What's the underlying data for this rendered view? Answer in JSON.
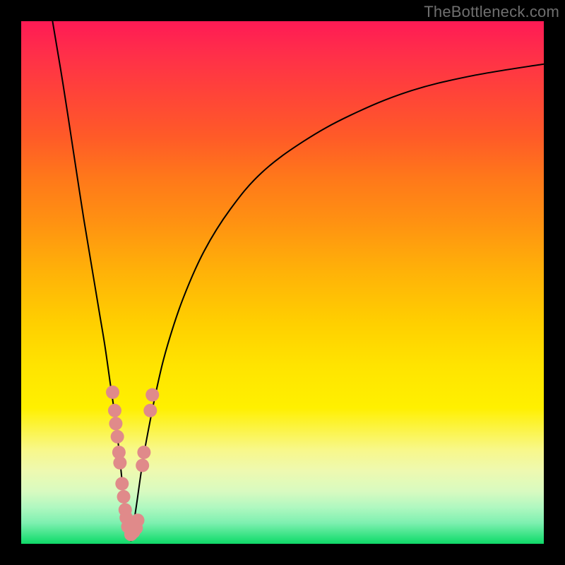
{
  "watermark": "TheBottleneck.com",
  "colors": {
    "curve_stroke": "#000000",
    "marker_fill": "#e08a8a",
    "marker_stroke": "#c06060",
    "frame": "#000000"
  },
  "chart_data": {
    "type": "line",
    "title": "",
    "xlabel": "",
    "ylabel": "",
    "xlim": [
      0,
      100
    ],
    "ylim": [
      0,
      100
    ],
    "series": [
      {
        "name": "left-branch",
        "x": [
          6,
          8,
          10,
          12,
          14,
          15,
          16,
          17,
          18,
          18.7,
          19.3,
          19.8,
          20.4,
          21
        ],
        "values": [
          100,
          88,
          75,
          62,
          50,
          44,
          38,
          31,
          24,
          18,
          12,
          7,
          3.5,
          0.5
        ]
      },
      {
        "name": "right-branch",
        "x": [
          21,
          22,
          23,
          24,
          26,
          28,
          31,
          35,
          40,
          46,
          54,
          63,
          74,
          86,
          100
        ],
        "values": [
          0.5,
          7,
          14,
          20,
          30,
          38,
          47,
          56,
          64,
          71,
          77,
          82,
          86.5,
          89.5,
          91.8
        ]
      }
    ],
    "markers": [
      {
        "x": 17.5,
        "y": 29
      },
      {
        "x": 17.9,
        "y": 25.5
      },
      {
        "x": 18.1,
        "y": 23
      },
      {
        "x": 18.4,
        "y": 20.5
      },
      {
        "x": 18.7,
        "y": 17.5
      },
      {
        "x": 18.9,
        "y": 15.5
      },
      {
        "x": 19.3,
        "y": 11.5
      },
      {
        "x": 19.6,
        "y": 9
      },
      {
        "x": 19.9,
        "y": 6.5
      },
      {
        "x": 20.1,
        "y": 5
      },
      {
        "x": 20.4,
        "y": 3.3
      },
      {
        "x": 21.0,
        "y": 1.8
      },
      {
        "x": 21.5,
        "y": 2.3
      },
      {
        "x": 22.0,
        "y": 3.0
      },
      {
        "x": 22.3,
        "y": 4.5
      },
      {
        "x": 23.2,
        "y": 15.0
      },
      {
        "x": 23.5,
        "y": 17.5
      },
      {
        "x": 24.7,
        "y": 25.5
      },
      {
        "x": 25.1,
        "y": 28.5
      }
    ]
  }
}
